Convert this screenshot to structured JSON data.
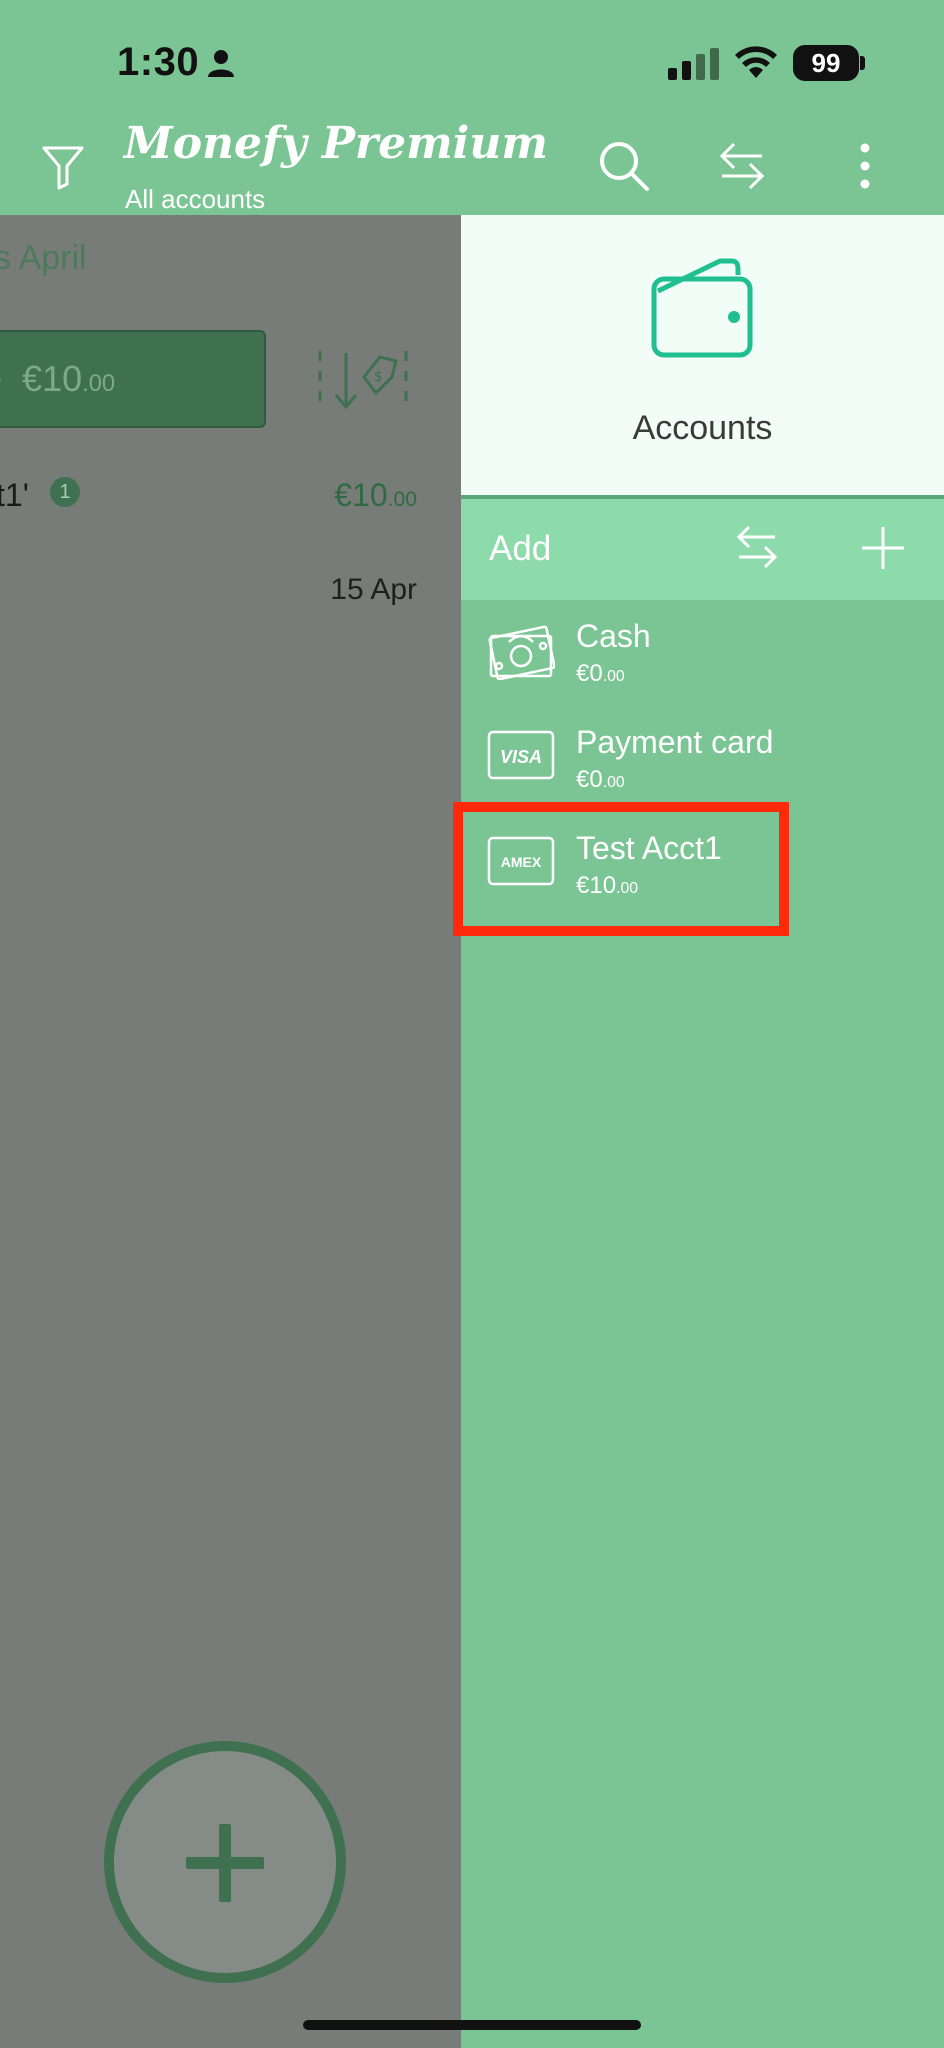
{
  "status_bar": {
    "time": "1:30",
    "battery": "99"
  },
  "header": {
    "title": "Monefy Premium",
    "subtitle": "All accounts"
  },
  "main": {
    "period": "s April",
    "expense_label": "e",
    "expense_currency": "€",
    "expense_main": "10",
    "expense_cents": ".00",
    "transaction": {
      "name": "t1'",
      "badge": "1",
      "amount_currency": "€",
      "amount_main": "10",
      "amount_cents": ".00",
      "date": "15 Apr"
    }
  },
  "drawer": {
    "title": "Accounts",
    "add_label": "Add",
    "accounts": [
      {
        "name": "Cash",
        "balance_main": "€0",
        "balance_cents": ".00",
        "icon": "cash-icon"
      },
      {
        "name": "Payment card",
        "balance_main": "€0",
        "balance_cents": ".00",
        "icon": "visa-card-icon",
        "icon_text": "VISA"
      },
      {
        "name": "Test Acct1",
        "balance_main": "€10",
        "balance_cents": ".00",
        "icon": "amex-card-icon",
        "icon_text": "AMEX"
      }
    ]
  },
  "colors": {
    "primary_green": "#7bc594",
    "drawer_action_bar": "#8ddbab",
    "drawer_header_bg": "#f2fdf8",
    "accent_teal": "#1fbf8f",
    "dark_green": "#3f7151",
    "highlight_red": "#ff2a0c",
    "dim_overlay": "#777c78"
  }
}
